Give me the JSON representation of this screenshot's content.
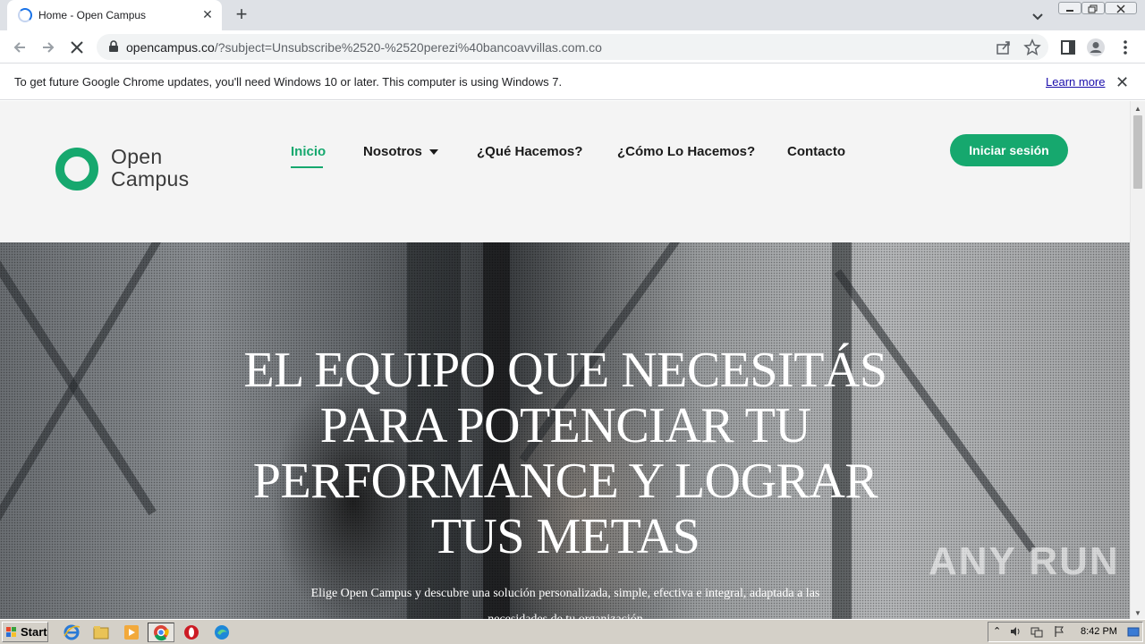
{
  "browser": {
    "tab_title": "Home - Open Campus",
    "new_tab_symbol": "+",
    "tab_close_symbol": "✕",
    "url_host": "opencampus.co",
    "url_path": "/?subject=Unsubscribe%2520-%2520perezi%40bancoavvillas.com.co"
  },
  "infobar": {
    "message": "To get future Google Chrome updates, you'll need Windows 10 or later. This computer is using Windows 7.",
    "link": "Learn more",
    "close_symbol": "✕"
  },
  "site": {
    "logo_line1": "Open",
    "logo_line2": "Campus",
    "brand_color": "#16a86e",
    "nav": [
      {
        "label": "Inicio",
        "active": true
      },
      {
        "label": "Nosotros",
        "has_dropdown": true
      },
      {
        "label": "¿Qué Hacemos?"
      },
      {
        "label": "¿Cómo Lo Hacemos?"
      },
      {
        "label": "Contacto"
      }
    ],
    "login_label": "Iniciar sesión",
    "hero_title_lines": [
      "EL EQUIPO QUE NECESITÁS",
      "PARA POTENCIAR TU",
      "PERFORMANCE Y LOGRAR",
      "TUS METAS"
    ],
    "hero_subtitle_lines": [
      "Elige Open Campus y descubre una solución personalizada, simple, efectiva e integral, adaptada a las",
      "necesidades de tu organización"
    ],
    "watermark": "ANY RUN"
  },
  "taskbar": {
    "start_label": "Start",
    "clock": "8:42 PM",
    "apps": [
      "internet-explorer-icon",
      "folder-icon",
      "media-player-icon",
      "chrome-icon",
      "opera-icon",
      "edge-icon"
    ]
  }
}
